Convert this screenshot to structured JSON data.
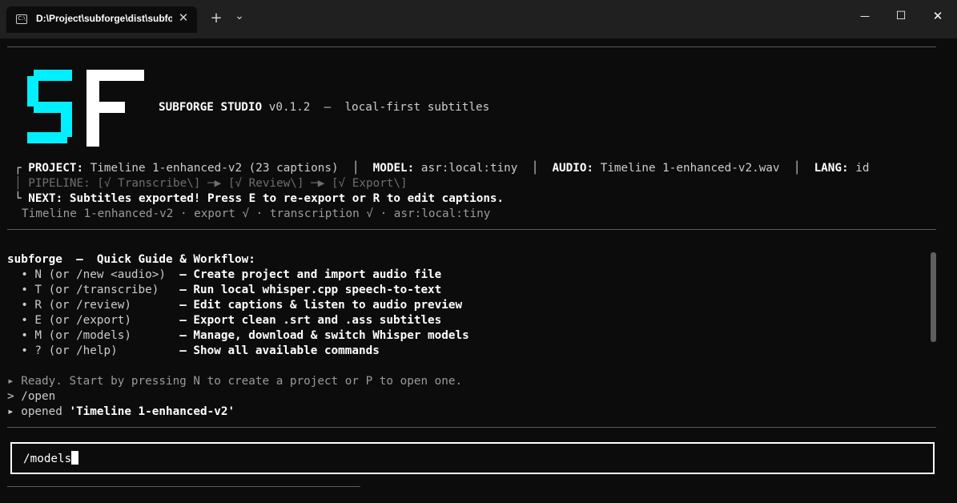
{
  "window": {
    "tab_title": "D:\\Project\\subforge\\dist\\subforge.exe",
    "new_tab": "+",
    "dropdown": "⌄",
    "minimize": "—",
    "maximize": "☐",
    "close": "✕",
    "tab_close": "✕",
    "tab_icon_label": "C:\\"
  },
  "header": {
    "app_name": "SUBFORGE STUDIO",
    "version": "v0.1.2",
    "dash": "—",
    "tagline": "local-first subtitles"
  },
  "status": {
    "project_label": "PROJECT:",
    "project_value": "Timeline 1-enhanced-v2 (23 captions)",
    "model_label": "MODEL:",
    "model_value": "asr:local:tiny",
    "audio_label": "AUDIO:",
    "audio_value": "Timeline 1-enhanced-v2.wav",
    "lang_label": "LANG:",
    "lang_value": "id",
    "pipeline_label": "PIPELINE:",
    "pipeline_value": "[√ Transcribe\\] ─▶ [√ Review\\] ─▶ [√ Export\\]",
    "next_label": "NEXT:",
    "next_value": "Subtitles exported! Press E to re-export or R to edit captions.",
    "summary": "Timeline 1-enhanced-v2 · export √ · transcription √ · asr:local:tiny"
  },
  "guide": {
    "title_bold": "subforge",
    "title_rest": "  —  Quick Guide & Workflow:",
    "items": [
      {
        "key": "  • N (or /new <audio>)  ",
        "desc": "— Create project and import audio file"
      },
      {
        "key": "  • T (or /transcribe)   ",
        "desc": "— Run local whisper.cpp speech-to-text"
      },
      {
        "key": "  • R (or /review)       ",
        "desc": "— Edit captions & listen to audio preview"
      },
      {
        "key": "  • E (or /export)       ",
        "desc": "— Export clean .srt and .ass subtitles"
      },
      {
        "key": "  • M (or /models)       ",
        "desc": "— Manage, download & switch Whisper models"
      },
      {
        "key": "  • ? (or /help)         ",
        "desc": "— Show all available commands"
      }
    ]
  },
  "log": {
    "line1": "▸ Ready. Start by pressing N to create a project or P to open one.",
    "line2": "> /open",
    "line3_prefix": "▸ opened ",
    "line3_value": "'Timeline 1-enhanced-v2'"
  },
  "input": {
    "value": "/models"
  },
  "colors": {
    "logo_s": "#00f0ff",
    "logo_f": "#ffffff",
    "background": "#0c0c0c"
  }
}
